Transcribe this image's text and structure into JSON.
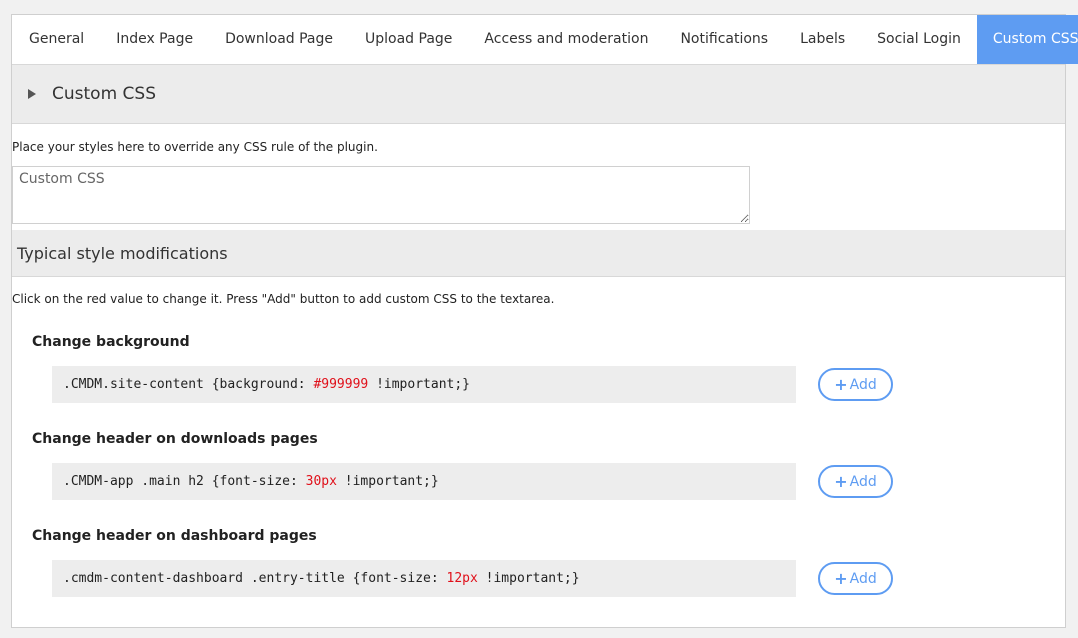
{
  "tabs": [
    {
      "label": "General",
      "active": false
    },
    {
      "label": "Index Page",
      "active": false
    },
    {
      "label": "Download Page",
      "active": false
    },
    {
      "label": "Upload Page",
      "active": false
    },
    {
      "label": "Access and moderation",
      "active": false
    },
    {
      "label": "Notifications",
      "active": false
    },
    {
      "label": "Labels",
      "active": false
    },
    {
      "label": "Social Login",
      "active": false
    },
    {
      "label": "Custom CSS",
      "active": true
    }
  ],
  "colors": {
    "accent": "#5e9cf2",
    "value_red": "#e0101a",
    "section_bg": "#ececec"
  },
  "custom_css": {
    "section_title": "Custom CSS",
    "description": "Place your styles here to override any CSS rule of the plugin.",
    "textarea_placeholder": "Custom CSS",
    "textarea_value": ""
  },
  "typical": {
    "section_title": "Typical style modifications",
    "hint": "Click on the red value to change it. Press \"Add\" button to add custom CSS to the textarea.",
    "add_label": "Add",
    "items": [
      {
        "title": "Change background",
        "prefix": ".CMDM.site-content {background: ",
        "value": "#999999",
        "suffix": " !important;}"
      },
      {
        "title": "Change header on downloads pages",
        "prefix": ".CMDM-app .main h2 {font-size: ",
        "value": "30px",
        "suffix": " !important;}"
      },
      {
        "title": "Change header on dashboard pages",
        "prefix": ".cmdm-content-dashboard .entry-title {font-size: ",
        "value": "12px",
        "suffix": " !important;}"
      }
    ]
  }
}
